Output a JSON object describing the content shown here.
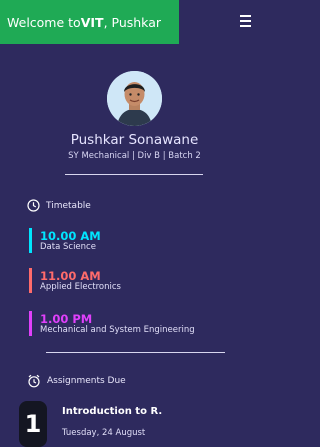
{
  "header": {
    "welcome_prefix": "Welcome to ",
    "welcome_brand": "VIT",
    "welcome_suffix": ", Pushkar"
  },
  "profile": {
    "name": "Pushkar Sonawane",
    "subtitle": "SY Mechanical | Div B | Batch 2"
  },
  "timetable": {
    "title": "Timetable",
    "items": [
      {
        "time": "10.00 AM",
        "subject": "Data Science",
        "time_color": "#00e5ff",
        "bar_color": "#00e5ff"
      },
      {
        "time": "11.00 AM",
        "subject": "Applied Electronics",
        "time_color": "#ff6b6b",
        "bar_color": "#ff6b6b"
      },
      {
        "time": "1.00 PM",
        "subject": "Mechanical and System Engineering",
        "time_color": "#e040fb",
        "bar_color": "#e040fb"
      }
    ]
  },
  "assignments": {
    "title": "Assignments Due",
    "items": [
      {
        "number": "1",
        "title": "Introduction to R.",
        "date": "Tuesday, 24 August"
      }
    ]
  }
}
